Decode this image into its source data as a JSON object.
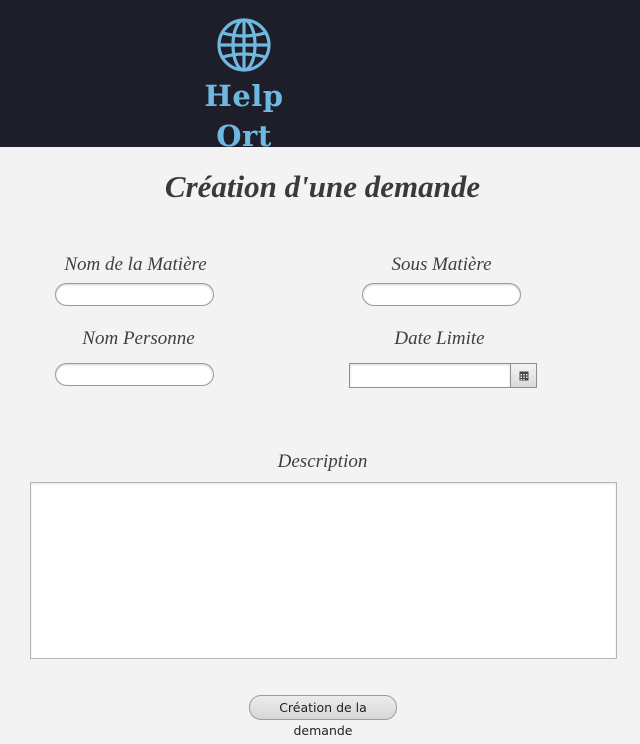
{
  "header": {
    "logo_icon": "globe-icon",
    "logo_text": "Help Ort",
    "logo_color": "#6fb8e0",
    "background": "#1e1e2b"
  },
  "form": {
    "title": "Création d'une demande",
    "fields": {
      "subject_name": {
        "label": "Nom de la Matière",
        "value": ""
      },
      "sub_subject": {
        "label": "Sous Matière",
        "value": ""
      },
      "person_name": {
        "label": "Nom Personne",
        "value": ""
      },
      "deadline": {
        "label": "Date Limite",
        "value": "",
        "button_icon": "calendar-icon"
      },
      "description": {
        "label": "Description",
        "value": ""
      }
    },
    "submit_label": "Création de la demande"
  }
}
